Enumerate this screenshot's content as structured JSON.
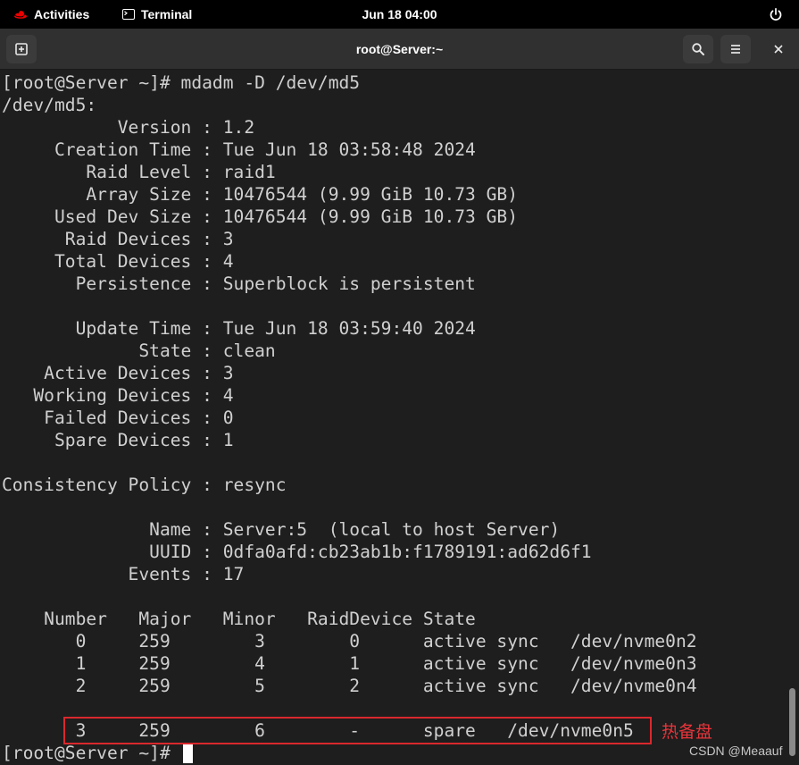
{
  "topbar": {
    "activities_label": "Activities",
    "app_label": "Terminal",
    "clock": "Jun 18  04:00"
  },
  "window": {
    "title": "root@Server:~"
  },
  "terminal": {
    "lines": [
      "[root@Server ~]# mdadm -D /dev/md5",
      "/dev/md5:",
      "           Version : 1.2",
      "     Creation Time : Tue Jun 18 03:58:48 2024",
      "        Raid Level : raid1",
      "        Array Size : 10476544 (9.99 GiB 10.73 GB)",
      "     Used Dev Size : 10476544 (9.99 GiB 10.73 GB)",
      "      Raid Devices : 3",
      "     Total Devices : 4",
      "       Persistence : Superblock is persistent",
      "",
      "       Update Time : Tue Jun 18 03:59:40 2024",
      "             State : clean",
      "    Active Devices : 3",
      "   Working Devices : 4",
      "    Failed Devices : 0",
      "     Spare Devices : 1",
      "",
      "Consistency Policy : resync",
      "",
      "              Name : Server:5  (local to host Server)",
      "              UUID : 0dfa0afd:cb23ab1b:f1789191:ad62d6f1",
      "            Events : 17",
      "",
      "    Number   Major   Minor   RaidDevice State",
      "       0     259        3        0      active sync   /dev/nvme0n2",
      "       1     259        4        1      active sync   /dev/nvme0n3",
      "       2     259        5        2      active sync   /dev/nvme0n4",
      "",
      "       3     259        6        -      spare   /dev/nvme0n5",
      "[root@Server ~]# "
    ]
  },
  "annotation": {
    "label": "热备盘",
    "color": "#d9282d"
  },
  "watermark": "CSDN @Meaauf",
  "colors": {
    "terminal_bg": "#1e1e1e",
    "terminal_fg": "#d0d0d0",
    "headerbar_bg": "#303030",
    "topbar_bg": "#000000",
    "redhat_red": "#ee0000"
  }
}
